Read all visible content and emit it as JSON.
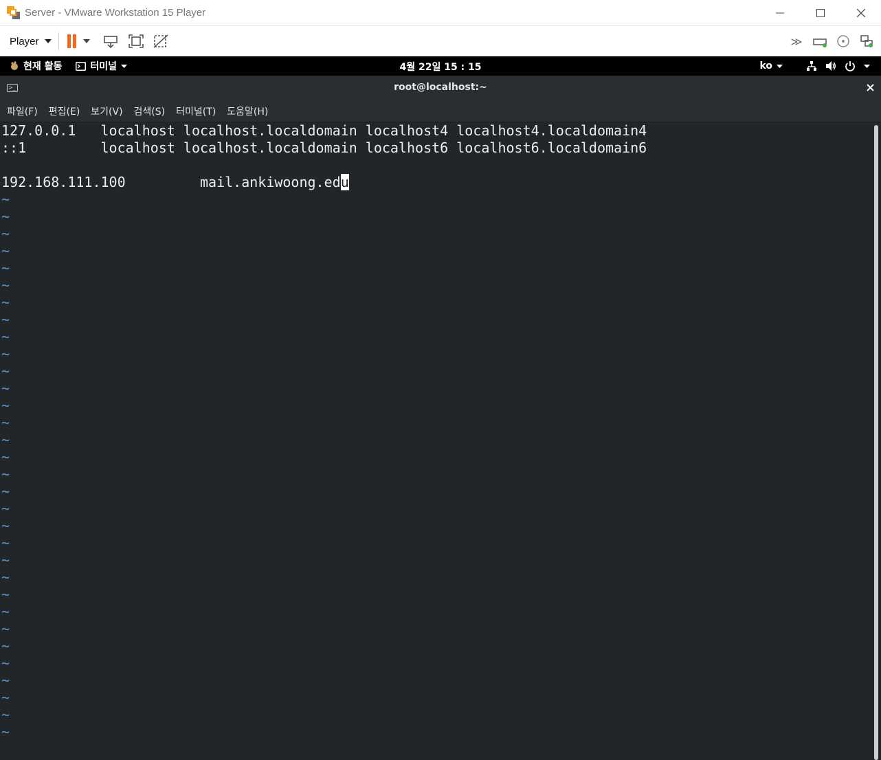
{
  "window": {
    "title": "Server - VMware Workstation 15 Player",
    "controls": {
      "minimize": "—",
      "maximize": "☐",
      "close": "✕"
    }
  },
  "toolbar": {
    "player_label": "Player",
    "accent_color": "#ee6a1c"
  },
  "gnome": {
    "activities": "현재 활동",
    "app_menu": "터미널",
    "clock": "4월 22일  15 : 15",
    "input_lang": "ko"
  },
  "terminal": {
    "title": "root@localhost:~",
    "menu": [
      "파일(F)",
      "편집(E)",
      "보기(V)",
      "검색(S)",
      "터미널(T)",
      "도움말(H)"
    ],
    "lines": [
      "127.0.0.1   localhost localhost.localdomain localhost4 localhost4.localdomain4",
      "::1         localhost localhost.localdomain localhost6 localhost6.localdomain6",
      "",
      "192.168.111.100         mail.ankiwoong.ed"
    ],
    "cursor_char": "u",
    "tilde": "~",
    "tilde_count": 32,
    "colors": {
      "background": "#222629",
      "text": "#ececec",
      "tilde": "#5a93c8"
    }
  }
}
